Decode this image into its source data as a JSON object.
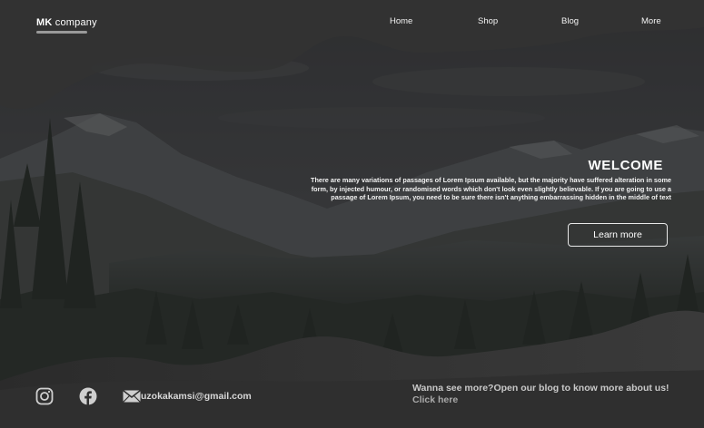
{
  "header": {
    "brand_bold": "MK",
    "brand_rest": " company",
    "nav": [
      "Home",
      "Shop",
      "Blog",
      "More"
    ]
  },
  "hero": {
    "heading": "WELCOME",
    "body": "There are many variations of passages of Lorem Ipsum available, but the majority have suffered alteration in some form, by injected humour, or randomised words which don't look even slightly believable. If you are going to use a passage of Lorem Ipsum, you need to be sure there isn't anything embarrassing hidden in the middle of text",
    "button_label": "Learn more",
    "background": "mountain-valley-forest-photo"
  },
  "footer": {
    "icons": [
      "instagram-icon",
      "facebook-icon",
      "mail-icon"
    ],
    "email": "uzokakamsi@gmail.com",
    "cta_text": "Wanna see more?Open our blog to know more about us!",
    "cta_link": "Click here"
  },
  "colors": {
    "background": "#2f2f2f",
    "overlay": "#242424",
    "text": "#ffffff",
    "muted_text": "#c9c9c9"
  }
}
